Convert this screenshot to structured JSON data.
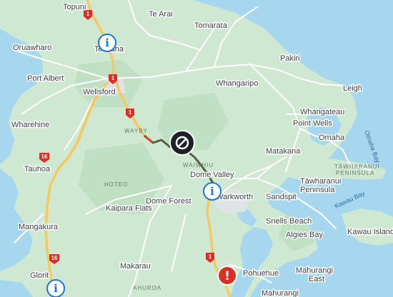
{
  "map": {
    "colors": {
      "water": "#a6d7ef",
      "land": "#cfe8d1",
      "land_alt": "#bfe0c3",
      "road": "#ffffff",
      "state_highway": "#f6c85f",
      "closure_route": "#56603f",
      "route_highlight": "#e04a2f",
      "info_marker": "#1a73e8",
      "alert_marker": "#d93025",
      "urban": "#dfe3e6"
    },
    "places": [
      {
        "id": "topuni",
        "label": "Topuni"
      },
      {
        "id": "te-arai",
        "label": "Te Arai"
      },
      {
        "id": "tomarata",
        "label": "Tomarata"
      },
      {
        "id": "oruawharo",
        "label": "Oruawharo"
      },
      {
        "id": "te-hana",
        "label": "Te Hāna"
      },
      {
        "id": "pakiri",
        "label": "Pakiri"
      },
      {
        "id": "port-albert",
        "label": "Port Albert"
      },
      {
        "id": "whangaripo",
        "label": "Whangaripo"
      },
      {
        "id": "leigh",
        "label": "Leigh"
      },
      {
        "id": "wellsford",
        "label": "Wellsford"
      },
      {
        "id": "whangateau",
        "label": "Whangateau"
      },
      {
        "id": "wharehine",
        "label": "Wharehine"
      },
      {
        "id": "point-wells",
        "label": "Point Wells"
      },
      {
        "id": "omaha",
        "label": "Omaha"
      },
      {
        "id": "matakana",
        "label": "Matakana"
      },
      {
        "id": "tauhoa",
        "label": "Tauhoa"
      },
      {
        "id": "dome-valley",
        "label": "Dome Valley"
      },
      {
        "id": "tawharanui",
        "label": "Tāwharanui\nPeninsula"
      },
      {
        "id": "warkworth",
        "label": "Warkworth"
      },
      {
        "id": "sandspit",
        "label": "Sandspit"
      },
      {
        "id": "dome-forest",
        "label": "Dome Forest"
      },
      {
        "id": "kaipara-flats",
        "label": "Kaipara Flats"
      },
      {
        "id": "snells-beach",
        "label": "Snells Beach"
      },
      {
        "id": "mangakura",
        "label": "Mangakura"
      },
      {
        "id": "algies-bay",
        "label": "Algies Bay"
      },
      {
        "id": "kawau-island",
        "label": "Kawau Island"
      },
      {
        "id": "makarau",
        "label": "Makarau"
      },
      {
        "id": "pohuehue",
        "label": "Pohuehue"
      },
      {
        "id": "mahurangi-east",
        "label": "Mahurangi\nEast"
      },
      {
        "id": "glorit",
        "label": "Glorit"
      },
      {
        "id": "mahurangi",
        "label": "Mahurangi"
      }
    ],
    "region_labels": [
      {
        "id": "wayby",
        "label": "WAYBY"
      },
      {
        "id": "hoteo",
        "label": "HOTEO"
      },
      {
        "id": "waiwhiu",
        "label": "WAIWHIU"
      },
      {
        "id": "tawharanui-peninsula",
        "label": "TĀWHARANUI\nPENINSULA"
      },
      {
        "id": "ahuroa",
        "label": "AHUROA"
      }
    ],
    "water_labels": [
      {
        "id": "omaha-bay",
        "label": "Omaha Bay"
      },
      {
        "id": "kawau-bay",
        "label": "Kawau Bay"
      }
    ],
    "route_shields": [
      {
        "id": "sh1-topuni",
        "label": "1"
      },
      {
        "id": "sh1-wellsford",
        "label": "1"
      },
      {
        "id": "sh1-wayby",
        "label": "1"
      },
      {
        "id": "sh1-south",
        "label": "1"
      },
      {
        "id": "sh16-tauhoa",
        "label": "16"
      },
      {
        "id": "sh16-glorit",
        "label": "16"
      }
    ],
    "markers": [
      {
        "id": "info-te-hana",
        "type": "info",
        "icon": "info-icon",
        "glyph": "i"
      },
      {
        "id": "closure-dome-valley",
        "type": "closure",
        "icon": "no-entry-icon"
      },
      {
        "id": "info-warkworth",
        "type": "info",
        "icon": "info-icon",
        "glyph": "i"
      },
      {
        "id": "alert-pohuehue",
        "type": "alert",
        "icon": "alert-icon",
        "glyph": "!"
      },
      {
        "id": "info-glorit",
        "type": "info",
        "icon": "info-icon",
        "glyph": "i"
      }
    ]
  }
}
